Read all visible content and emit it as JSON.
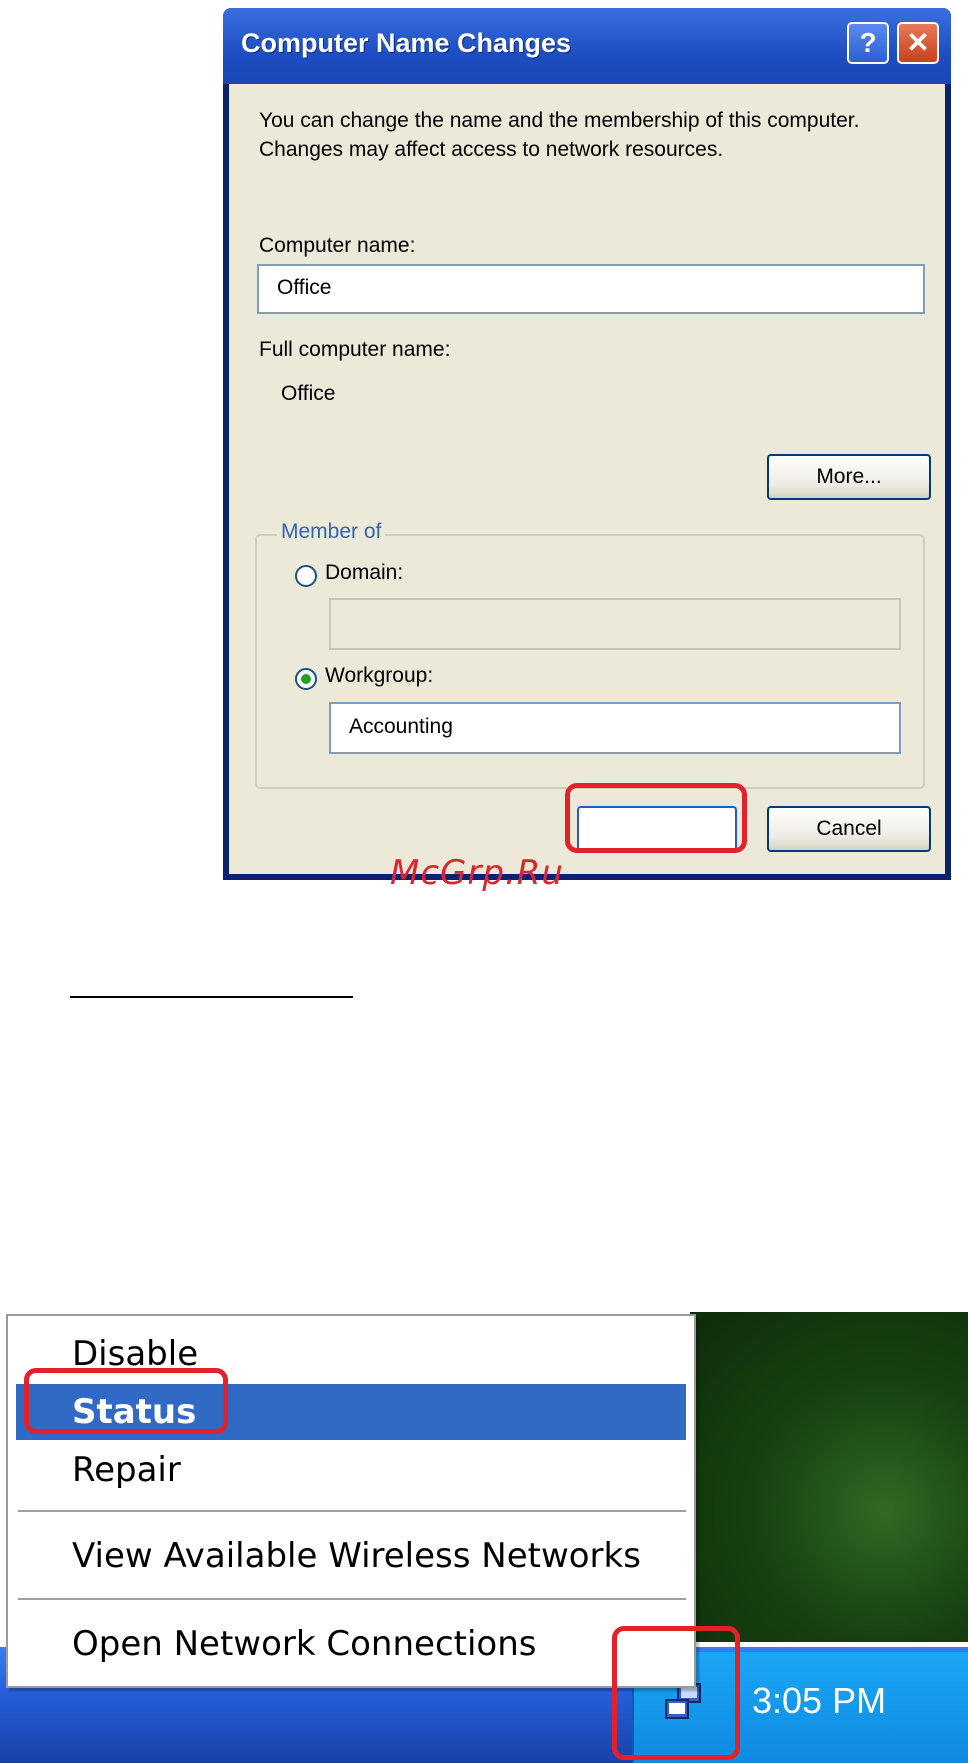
{
  "dialog": {
    "title": "Computer Name Changes",
    "help_icon": "?",
    "close_icon": "✕",
    "description": "You can change the name and the membership of this computer. Changes may affect access to network resources.",
    "computer_name_label": "Computer name:",
    "computer_name_value": "Office",
    "full_name_label": "Full computer name:",
    "full_name_value": "Office",
    "more_button": "More...",
    "member_of_label": "Member of",
    "domain_label": "Domain:",
    "domain_value": "",
    "workgroup_label": "Workgroup:",
    "workgroup_value": "Accounting",
    "ok_button": "",
    "cancel_button": "Cancel",
    "selected_membership": "workgroup"
  },
  "watermark": "McGrp.Ru",
  "context_menu": {
    "items": [
      "Disable",
      "Status",
      "Repair",
      "View Available Wireless Networks",
      "Open Network Connections"
    ],
    "selected": "Status"
  },
  "taskbar": {
    "clock": "3:05 PM",
    "tray_icon": "network-connection-icon"
  },
  "colors": {
    "highlight_red": "#e3212b",
    "menu_selection": "#316ac5",
    "titlebar_blue": "#1d4ec2",
    "taskbar_blue": "#245edb"
  }
}
